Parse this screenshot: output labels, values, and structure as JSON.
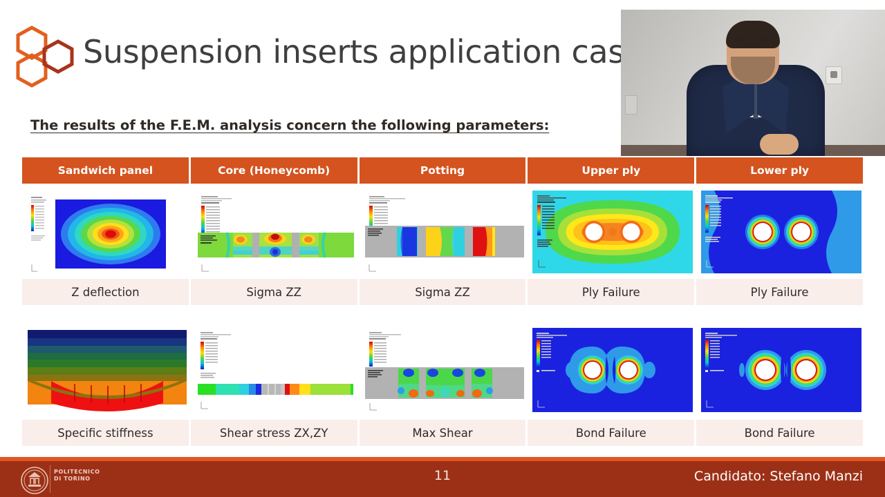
{
  "slide": {
    "title": "Suspension inserts application case",
    "subtitle": "The results of the F.E.M. analysis concern the following parameters:",
    "logo_icon": "hexagon-cluster-logo"
  },
  "table": {
    "columns": [
      "Sandwich panel",
      "Core (Honeycomb)",
      "Potting",
      "Upper ply",
      "Lower ply"
    ],
    "rows": [
      {
        "labels": [
          "Z deflection",
          "Sigma ZZ",
          "Sigma ZZ",
          "Ply Failure",
          "Ply Failure"
        ],
        "figures": [
          "fem-contour-z-deflection",
          "fem-core-sigma-zz",
          "fem-potting-sigma-zz",
          "fem-upper-ply-failure",
          "fem-lower-ply-failure"
        ]
      },
      {
        "labels": [
          "Specific stiffness",
          "Shear stress ZX,ZY",
          "Max Shear",
          "Bond Failure",
          "Bond Failure"
        ],
        "figures": [
          "fem-specific-stiffness",
          "fem-shear-stress-zx-zy",
          "fem-max-shear",
          "fem-upper-bond-failure",
          "fem-lower-bond-failure"
        ]
      }
    ]
  },
  "footer": {
    "institution_line1": "POLITECNICO",
    "institution_line2": "DI TORINO",
    "page_number": "11",
    "candidate": "Candidato: Stefano Manzi"
  },
  "webcam": {
    "label": "presenter-video-feed"
  },
  "colors": {
    "header_orange": "#d4531f",
    "label_pink": "#faeeeb",
    "footer_red": "#9c3016",
    "footer_accent": "#e1551f",
    "title_gray": "#3f3f3f"
  }
}
